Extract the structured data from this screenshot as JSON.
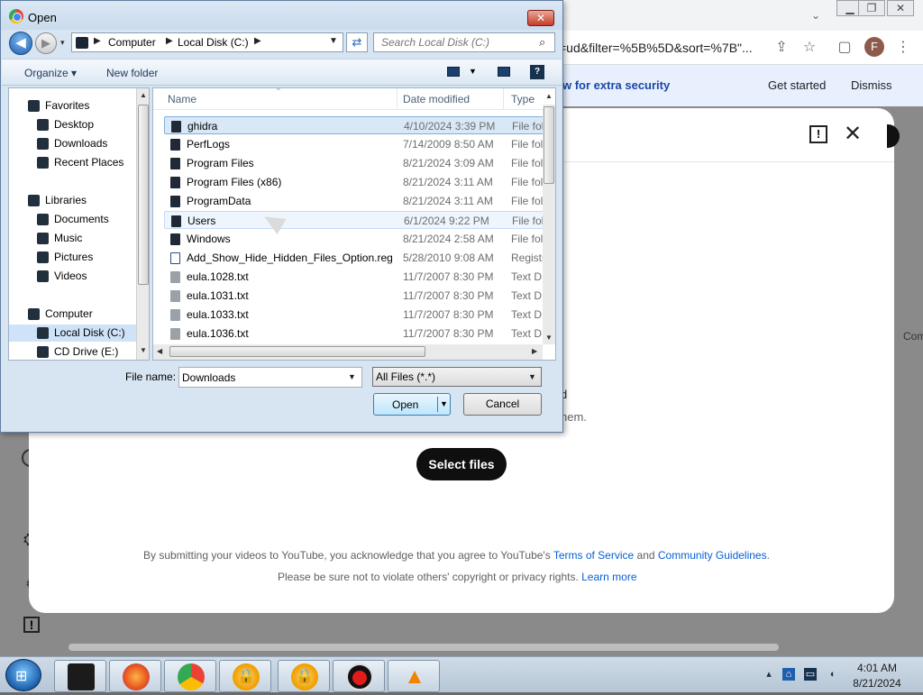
{
  "browser": {
    "omnibox_text": "=ud&filter=%5B%5D&sort=%7B\"...",
    "profile_initial": "F",
    "window_controls": [
      "minimize-icon",
      "restore-icon",
      "close-icon"
    ],
    "toolbar_icons": [
      "share-icon",
      "bookmark-star-icon",
      "side-panel-icon",
      "menu-kebab-icon"
    ]
  },
  "youtube": {
    "banner_message": "w for extra security",
    "banner_get_started": "Get started",
    "banner_dismiss": "Dismiss",
    "edge_text": "Com",
    "desc_tail": "hem.",
    "desc_tail_top": "d",
    "select_files_label": "Select files",
    "legal_line1_prefix": "By submitting your videos to YouTube, you acknowledge that you agree to YouTube's ",
    "terms_link": "Terms of Service",
    "legal_line1_and": " and ",
    "guidelines_link": "Community Guidelines",
    "legal_line1_suffix": ".",
    "legal_line2_prefix": "Please be sure not to violate others' copyright or privacy rights. ",
    "learn_more_link": "Learn more"
  },
  "dialog": {
    "title": "Open",
    "breadcrumb": [
      "Computer",
      "Local Disk (C:)"
    ],
    "search_placeholder": "Search Local Disk (C:)",
    "organize_label": "Organize ▾",
    "new_folder_label": "New folder",
    "nav_items": [
      {
        "label": "Favorites",
        "icon": "star-icon",
        "level": 0
      },
      {
        "label": "Desktop",
        "icon": "desktop-icon",
        "level": 1
      },
      {
        "label": "Downloads",
        "icon": "downloads-icon",
        "level": 1
      },
      {
        "label": "Recent Places",
        "icon": "recent-places-icon",
        "level": 1
      },
      {
        "label": "Libraries",
        "icon": "libraries-icon",
        "level": 0
      },
      {
        "label": "Documents",
        "icon": "documents-icon",
        "level": 1
      },
      {
        "label": "Music",
        "icon": "music-icon",
        "level": 1
      },
      {
        "label": "Pictures",
        "icon": "pictures-icon",
        "level": 1
      },
      {
        "label": "Videos",
        "icon": "videos-icon",
        "level": 1
      },
      {
        "label": "Computer",
        "icon": "computer-icon",
        "level": 0
      },
      {
        "label": "Local Disk (C:)",
        "icon": "drive-icon",
        "level": 1,
        "selected": true
      },
      {
        "label": "CD Drive (E:)",
        "icon": "cd-drive-icon",
        "level": 1
      }
    ],
    "columns": [
      "Name",
      "Date modified",
      "Type"
    ],
    "files": [
      {
        "name": "ghidra",
        "date": "4/10/2024 3:39 PM",
        "type": "File fol",
        "icon": "folder-icon",
        "selected": true
      },
      {
        "name": "PerfLogs",
        "date": "7/14/2009 8:50 AM",
        "type": "File fol",
        "icon": "folder-icon"
      },
      {
        "name": "Program Files",
        "date": "8/21/2024 3:09 AM",
        "type": "File fol",
        "icon": "folder-icon"
      },
      {
        "name": "Program Files (x86)",
        "date": "8/21/2024 3:11 AM",
        "type": "File fol",
        "icon": "folder-icon"
      },
      {
        "name": "ProgramData",
        "date": "8/21/2024 3:11 AM",
        "type": "File fol",
        "icon": "folder-icon"
      },
      {
        "name": "Users",
        "date": "6/1/2024 9:22 PM",
        "type": "File fol",
        "icon": "folder-icon",
        "hover": true
      },
      {
        "name": "Windows",
        "date": "8/21/2024 2:58 AM",
        "type": "File fol",
        "icon": "folder-icon"
      },
      {
        "name": "Add_Show_Hide_Hidden_Files_Option.reg",
        "date": "5/28/2010 9:08 AM",
        "type": "Registr",
        "icon": "registry-file-icon"
      },
      {
        "name": "eula.1028.txt",
        "date": "11/7/2007 8:30 PM",
        "type": "Text D",
        "icon": "text-file-icon"
      },
      {
        "name": "eula.1031.txt",
        "date": "11/7/2007 8:30 PM",
        "type": "Text D",
        "icon": "text-file-icon"
      },
      {
        "name": "eula.1033.txt",
        "date": "11/7/2007 8:30 PM",
        "type": "Text D",
        "icon": "text-file-icon"
      },
      {
        "name": "eula.1036.txt",
        "date": "11/7/2007 8:30 PM",
        "type": "Text D",
        "icon": "text-file-icon"
      }
    ],
    "file_name_label": "File name:",
    "file_name_value": "Downloads",
    "file_type_filter": "All Files (*.*)",
    "open_label": "Open",
    "cancel_label": "Cancel"
  },
  "taskbar": {
    "apps": [
      "explorer-icon",
      "firefox-icon",
      "chrome-icon",
      "security-app-icon",
      "security-app-icon",
      "record-icon",
      "vlc-icon"
    ],
    "time": "4:01 AM",
    "date": "8/21/2024"
  },
  "colors": {
    "youtube_link": "#065fd4",
    "select_files_bg": "#0f0f0f",
    "dialog_frame": "#d7e4f1",
    "selection": "#d9e8f7"
  }
}
